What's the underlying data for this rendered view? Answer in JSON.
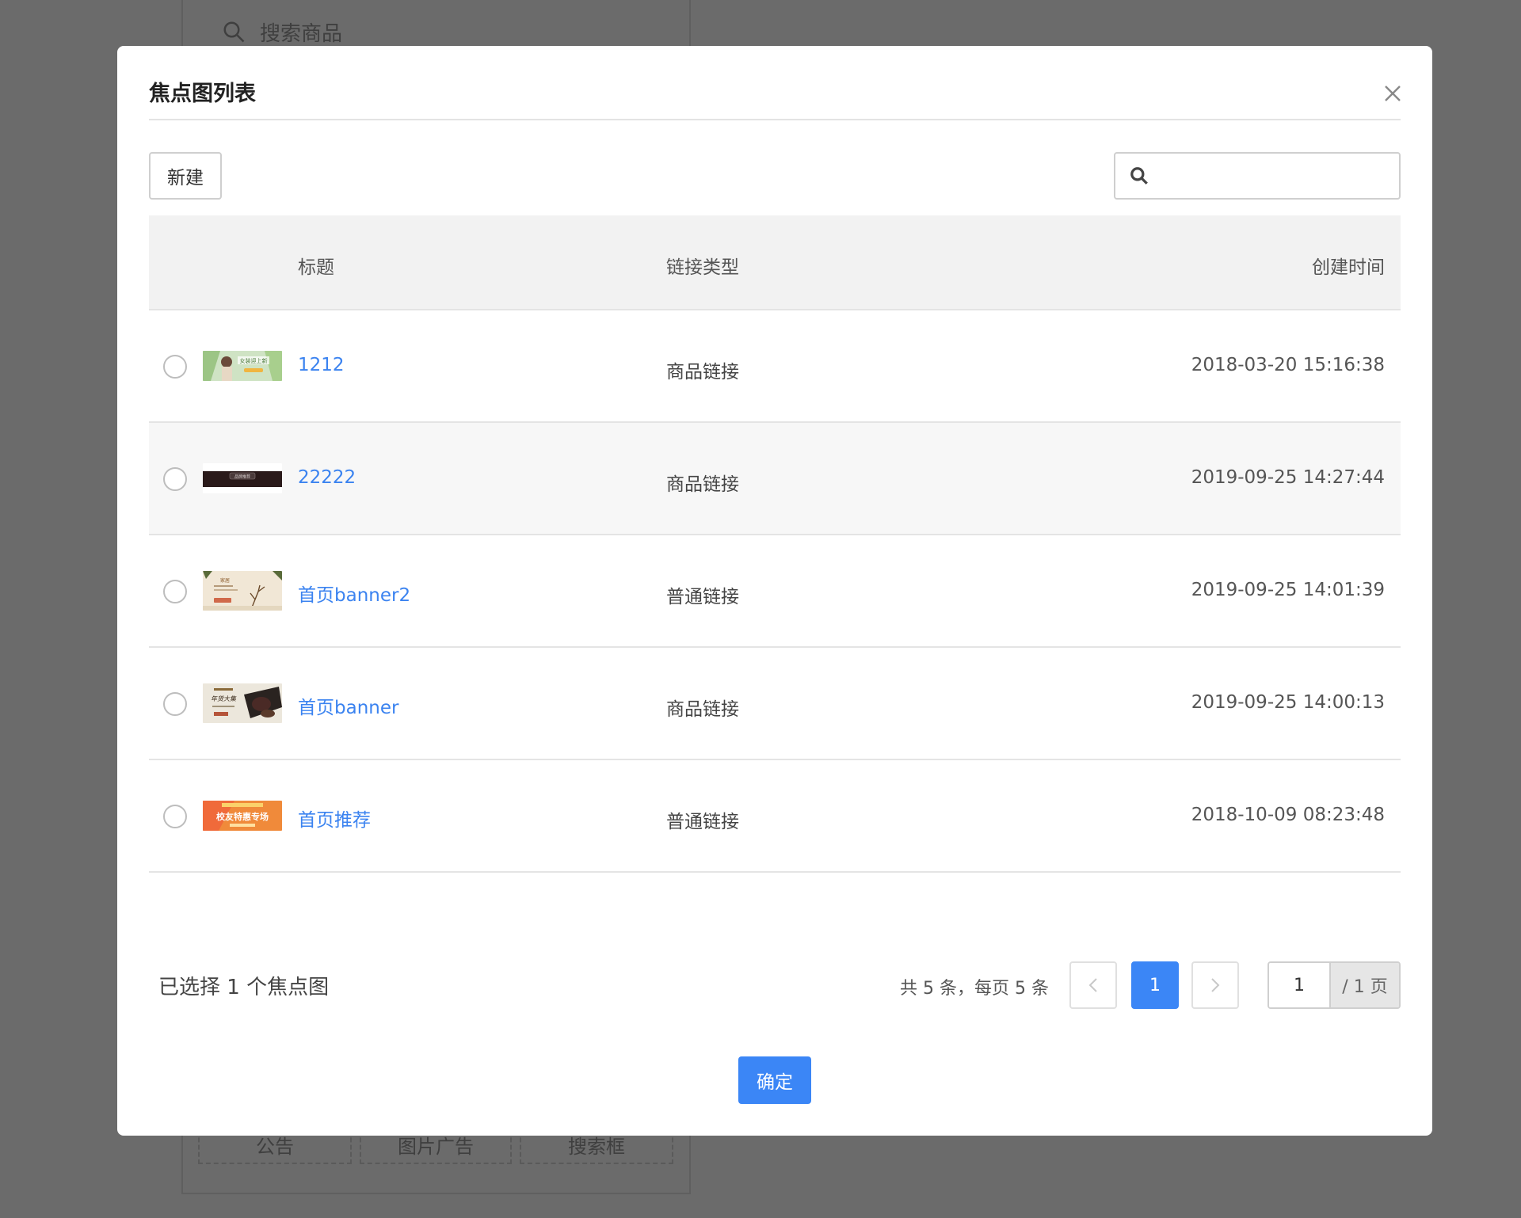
{
  "background": {
    "search_placeholder": "搜索商品",
    "tiles": [
      "公告",
      "图片广告",
      "搜索框"
    ]
  },
  "modal": {
    "title": "焦点图列表",
    "new_button": "新建",
    "search_value": "",
    "columns": {
      "title": "标题",
      "link_type": "链接类型",
      "created_at": "创建时间"
    },
    "rows": [
      {
        "title": "1212",
        "link_type": "商品链接",
        "created_at": "2018-03-20 15:16:38",
        "thumb_text": "女装迎上新"
      },
      {
        "title": "22222",
        "link_type": "商品链接",
        "created_at": "2019-09-25 14:27:44",
        "thumb_text": "品牌推荐"
      },
      {
        "title": "首页banner2",
        "link_type": "普通链接",
        "created_at": "2019-09-25 14:01:39",
        "thumb_text": "家居"
      },
      {
        "title": "首页banner",
        "link_type": "商品链接",
        "created_at": "2019-09-25 14:00:13",
        "thumb_text": "年货大集"
      },
      {
        "title": "首页推荐",
        "link_type": "普通链接",
        "created_at": "2018-10-09 08:23:48",
        "thumb_text": "校友特惠专场"
      }
    ],
    "selected_text": "已选择 1 个焦点图",
    "pagination": {
      "total_text": "共 5 条，每页 5 条",
      "current_page": "1",
      "jump_value": "1",
      "total_pages_text": "/ 1 页"
    },
    "confirm_button": "确定"
  },
  "colors": {
    "accent": "#3b86f6",
    "link": "#3b83f0",
    "overlay": "#6b6b6b"
  }
}
